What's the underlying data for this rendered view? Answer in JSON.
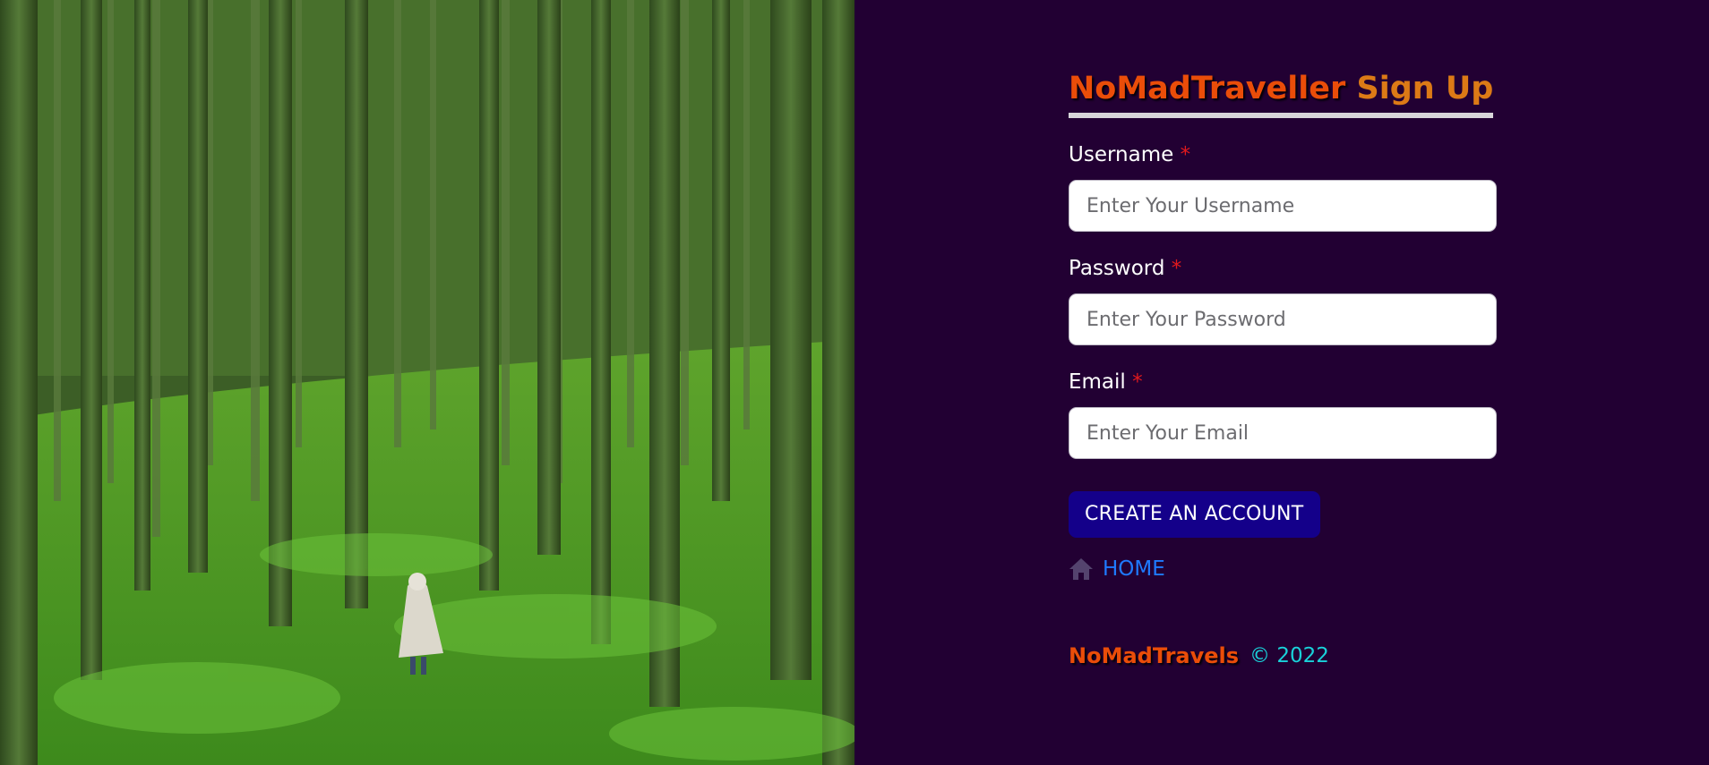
{
  "hero": {
    "image_icon": "forest-photo"
  },
  "form": {
    "title_brand": "NoMadTraveller",
    "title_rest": "Sign Up",
    "fields": [
      {
        "label": "Username",
        "required_mark": "*",
        "placeholder": "Enter Your Username",
        "value": ""
      },
      {
        "label": "Password",
        "required_mark": "*",
        "placeholder": "Enter Your Password",
        "value": ""
      },
      {
        "label": "Email",
        "required_mark": "*",
        "placeholder": "Enter Your Email",
        "value": ""
      }
    ],
    "submit_label": "CREATE AN ACCOUNT",
    "home_icon": "home-icon",
    "home_label": "HOME"
  },
  "footer": {
    "brand": "NoMadTravels",
    "copyright": "© 2022"
  },
  "colors": {
    "panel_bg": "#220033",
    "brand": "#ea4d09",
    "title_accent": "#dc7a16",
    "required": "#e2191d",
    "button_bg": "#14008a",
    "link": "#1f7aff",
    "copyright": "#19d2da"
  }
}
